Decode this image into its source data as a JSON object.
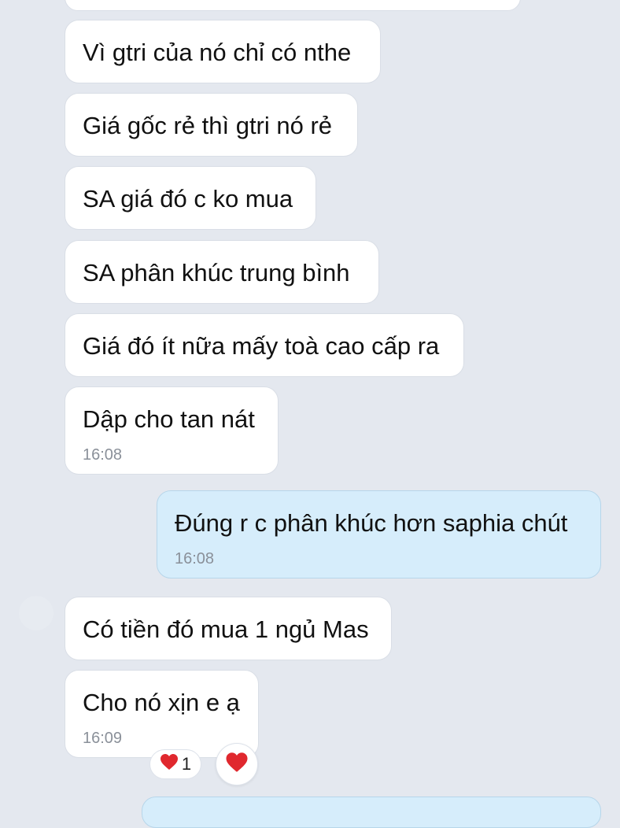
{
  "colors": {
    "background": "#e4e8ef",
    "incoming_bubble": "#ffffff",
    "outgoing_bubble": "#d6edfb",
    "timestamp": "#8a9099",
    "heart": "#e0282e"
  },
  "messages": [
    {
      "text": "",
      "direction": "incoming"
    },
    {
      "text": "Vì gtri của nó chỉ có nthe",
      "direction": "incoming"
    },
    {
      "text": "Giá gốc rẻ thì gtri nó rẻ",
      "direction": "incoming"
    },
    {
      "text": "SA giá đó c ko mua",
      "direction": "incoming"
    },
    {
      "text": "SA phân khúc trung bình",
      "direction": "incoming"
    },
    {
      "text": "Giá đó ít nữa mấy toà cao cấp ra",
      "direction": "incoming"
    },
    {
      "text": "Dập cho tan nát",
      "time": "16:08",
      "direction": "incoming"
    },
    {
      "text": "Đúng r c phân khúc hơn saphia chút",
      "time": "16:08",
      "direction": "outgoing"
    },
    {
      "text": "Có tiền đó mua 1 ngủ Mas",
      "direction": "incoming"
    },
    {
      "text": "Cho nó xịn e ạ",
      "time": "16:09",
      "direction": "incoming"
    },
    {
      "text": "",
      "direction": "outgoing"
    }
  ],
  "reactions": {
    "count_icon": "heart-icon",
    "count": "1",
    "add_icon": "heart-icon"
  }
}
